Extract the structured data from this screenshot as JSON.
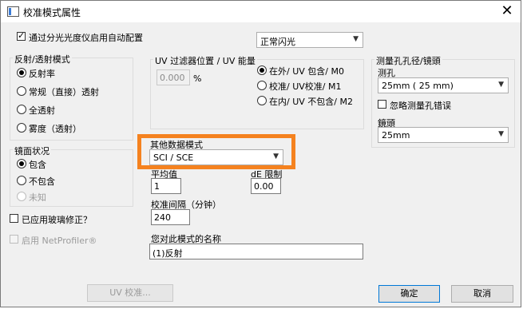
{
  "window": {
    "title": "校准模式属性",
    "close_icon": "close-icon"
  },
  "top": {
    "use_auto_config_label": "通过分光光度仪启用自动配置",
    "use_auto_config_checked": true,
    "flash_select": "正常闪光"
  },
  "reflect_group": {
    "title": "反射/透射模式",
    "options": [
      {
        "label": "反射率",
        "checked": true
      },
      {
        "label": "常规（直接）透射",
        "checked": false
      },
      {
        "label": "全透射",
        "checked": false
      },
      {
        "label": "雾度（透射）",
        "checked": false
      }
    ]
  },
  "specular_group": {
    "title": "镜面状况",
    "options": [
      {
        "label": "包含",
        "checked": true,
        "disabled": false
      },
      {
        "label": "不包含",
        "checked": false,
        "disabled": false
      },
      {
        "label": "未知",
        "checked": false,
        "disabled": true
      }
    ]
  },
  "glass_correction": {
    "label": "已应用玻璃修正？",
    "checked": false
  },
  "netprofiler": {
    "label": "启用 NetProfiler®",
    "checked": false,
    "disabled": true
  },
  "uv_group": {
    "title": "UV 过滤器位置 / UV 能量",
    "value": "0.000",
    "unit": "%",
    "options": [
      {
        "label": "在外/ UV 包含/ M0",
        "checked": true
      },
      {
        "label": "校准/ UV校准/ M1",
        "checked": false
      },
      {
        "label": "在内/ UV 不包含/ M2",
        "checked": false
      }
    ]
  },
  "other_mode": {
    "label": "其他数据模式",
    "value": "SCI / SCE"
  },
  "average": {
    "label": "平均值",
    "value": "1"
  },
  "de_limit": {
    "label": "dE 限制",
    "value": "0.00"
  },
  "interval": {
    "label": "校准间隔（分钟）",
    "value": "240"
  },
  "mode_name": {
    "label": "您对此模式的名称",
    "value": "(1)反射"
  },
  "aperture_group": {
    "title": "测量孔孔径/镜頭",
    "aperture_label": "测孔",
    "aperture_value": "25mm ( 25 mm)",
    "ignore_label": "忽略测量孔错误",
    "ignore_checked": false,
    "lens_label": "鏡頭",
    "lens_value": "25mm"
  },
  "buttons": {
    "uv_calibrate": "UV 校准...",
    "ok": "确定",
    "cancel": "取消"
  }
}
